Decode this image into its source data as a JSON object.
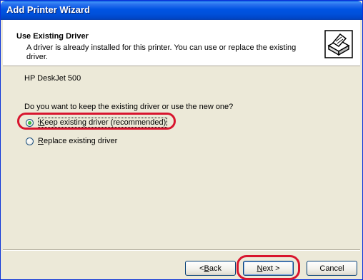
{
  "window": {
    "title": "Add Printer Wizard"
  },
  "header": {
    "title": "Use Existing Driver",
    "description": "A driver is already installed for this printer. You can use or replace the existing driver."
  },
  "content": {
    "printer_name": "HP DeskJet 500",
    "question": "Do you want to keep the existing driver or use the new one?",
    "options": [
      {
        "mnemonic": "K",
        "rest": "eep existing driver (recommended)",
        "selected": true
      },
      {
        "mnemonic": "R",
        "rest": "eplace existing driver",
        "selected": false
      }
    ]
  },
  "buttons": {
    "back": {
      "prefix": "< ",
      "mnemonic": "B",
      "rest": "ack"
    },
    "next": {
      "mnemonic": "N",
      "rest": "ext >"
    },
    "cancel": {
      "label": "Cancel"
    }
  },
  "colors": {
    "highlight": "#D8152E",
    "titlebar": "#0054E3",
    "dialog_bg": "#ECE9D8"
  }
}
